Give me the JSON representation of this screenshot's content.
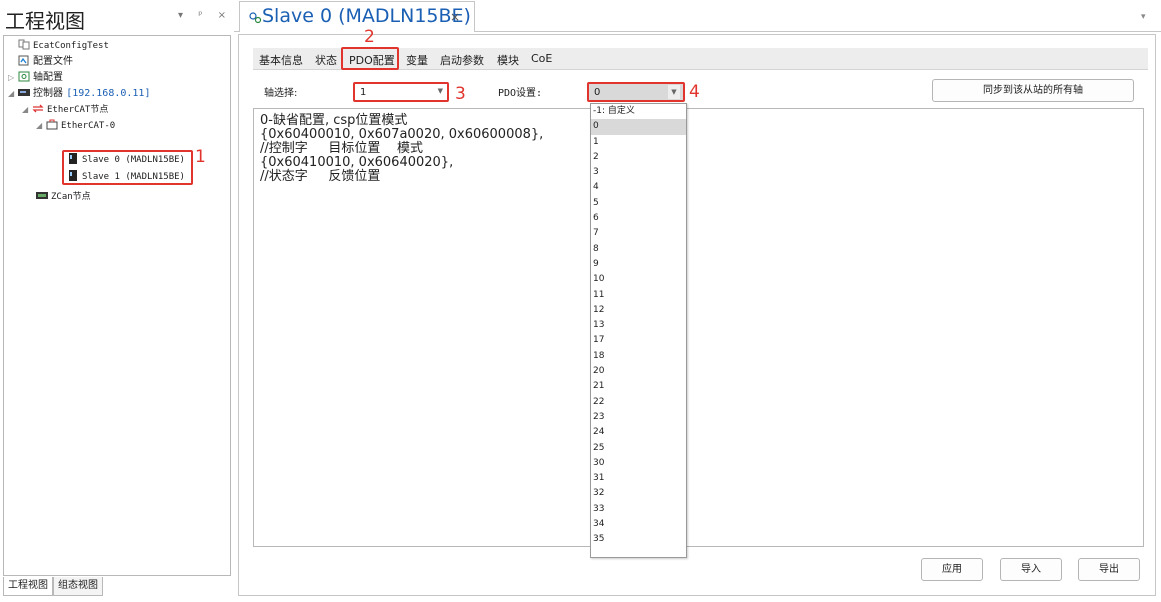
{
  "left_panel": {
    "title": "工程视图",
    "controls": "▾ ᵖ ×",
    "tree": {
      "ecat_config": "EcatConfigTest",
      "config_file": "配置文件",
      "axis_config": "轴配置",
      "controller_label": "控制器",
      "controller_ip": "[192.168.0.11]",
      "ethercat_node": "EtherCAT节点",
      "ethercat_0": "EtherCAT-0",
      "slave0": "Slave 0 (MADLN15BE)",
      "slave1": "Slave 1 (MADLN15BE)",
      "zcan_node": "ZCan节点"
    },
    "bottom_tabs": [
      "工程视图",
      "组态视图"
    ]
  },
  "document_tab": {
    "title": "Slave 0 (MADLN15BE)",
    "close": "×",
    "dropdown": "▾"
  },
  "annotations": [
    "1",
    "2",
    "3",
    "4"
  ],
  "annotation_color": "#e0342c",
  "accent_color": "#1a5fb4",
  "sub_tabs": [
    "基本信息",
    "状态",
    "PDO配置",
    "变量",
    "启动参数",
    "模块",
    "CoE"
  ],
  "form": {
    "axis_label": "轴选择:",
    "axis_value": "1",
    "pdo_label": "PDO设置:",
    "pdo_value": "0",
    "sync_button": "同步到该从站的所有轴"
  },
  "editor_lines": [
    "0-缺省配置, csp位置模式",
    "{0x60400010, 0x607a0020, 0x60600008},",
    "//控制字     目标位置    模式",
    "{0x60410010, 0x60640020},",
    "//状态字     反馈位置"
  ],
  "dropdown_options": [
    "-1: 自定义",
    "0",
    "1",
    "2",
    "3",
    "4",
    "5",
    "6",
    "7",
    "8",
    "9",
    "10",
    "11",
    "12",
    "13",
    "17",
    "18",
    "20",
    "21",
    "22",
    "23",
    "24",
    "25",
    "30",
    "31",
    "32",
    "33",
    "34",
    "35"
  ],
  "selected_option": "0",
  "footer_buttons": {
    "apply": "应用",
    "import": "导入",
    "export": "导出"
  }
}
